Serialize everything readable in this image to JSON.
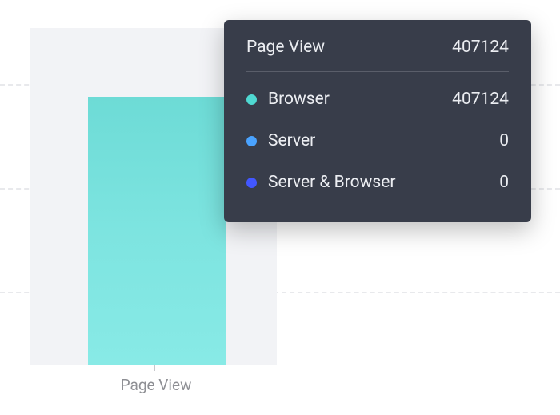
{
  "chart_data": {
    "type": "bar",
    "categories": [
      "Page View"
    ],
    "series": [
      {
        "name": "Browser",
        "values": [
          407124
        ],
        "color": "#4fd9d2"
      },
      {
        "name": "Server",
        "values": [
          0
        ],
        "color": "#4aa3ff"
      },
      {
        "name": "Server & Browser",
        "values": [
          0
        ],
        "color": "#4257ff"
      }
    ],
    "title": "",
    "xlabel": "",
    "ylabel": "",
    "ylim": [
      0,
      500000
    ]
  },
  "axis": {
    "x_tick_label": "Page View"
  },
  "tooltip": {
    "title": "Page View",
    "total": "407124",
    "rows": [
      {
        "label": "Browser",
        "value": "407124",
        "color": "#4fd9d2"
      },
      {
        "label": "Server",
        "value": "0",
        "color": "#4aa3ff"
      },
      {
        "label": "Server & Browser",
        "value": "0",
        "color": "#4257ff"
      }
    ]
  }
}
